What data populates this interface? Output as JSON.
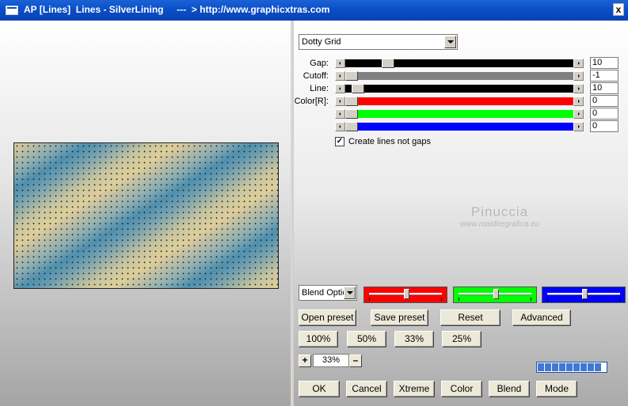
{
  "window": {
    "title": "AP [Lines]  Lines - SilverLining     ---  > http://www.graphicxtras.com",
    "close_glyph": "x"
  },
  "preset_select": {
    "value": "Dotty Grid"
  },
  "sliders": [
    {
      "label": "Gap:",
      "value": "10",
      "color": "#000000",
      "level": 0.17
    },
    {
      "label": "Cutoff:",
      "value": "-1",
      "color": "#808080",
      "level": 0.0
    },
    {
      "label": "Line:",
      "value": "10",
      "color": "#000000",
      "level": 0.03
    },
    {
      "label": "Color[R]:",
      "value": "0",
      "color": "#ff0000",
      "level": 0.0
    },
    {
      "label": "",
      "value": "0",
      "color": "#00ff00",
      "level": 0.0
    },
    {
      "label": "",
      "value": "0",
      "color": "#0000ff",
      "level": 0.0
    }
  ],
  "create_lines": {
    "label": "Create lines not gaps",
    "checked": true,
    "mark": "✓"
  },
  "watermark": {
    "name": "Pinuccia",
    "url": "www.maidiregrafica.eu"
  },
  "blend_select": {
    "value": "Blend Optio"
  },
  "blend_sliders": [
    {
      "color": "#ff0000",
      "level": 0.5
    },
    {
      "color": "#00ff00",
      "level": 0.5
    },
    {
      "color": "#0000ff",
      "level": 0.5
    }
  ],
  "buttons": {
    "open_preset": "Open preset",
    "save_preset": "Save preset",
    "reset": "Reset",
    "advanced": "Advanced",
    "zoom_100": "100%",
    "zoom_50": "50%",
    "zoom_33": "33%",
    "zoom_25": "25%",
    "ok": "OK",
    "cancel": "Cancel",
    "xtreme": "Xtreme",
    "color": "Color",
    "blend": "Blend",
    "mode": "Mode"
  },
  "zoom": {
    "plus": "+",
    "minus": "–",
    "value": "33%"
  },
  "progress": {
    "segments": 9
  }
}
